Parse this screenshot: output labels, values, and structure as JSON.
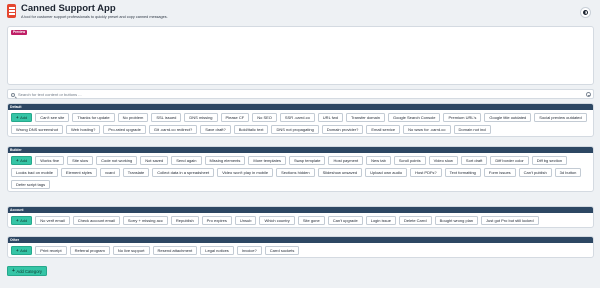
{
  "app": {
    "title": "Canned Support App",
    "subtitle": "A tool for customer support professionals to quickly preset and copy canned messages.",
    "logo_icon": "notebook-icon",
    "theme_icon": "contrast-icon"
  },
  "preview": {
    "badge": "Preview"
  },
  "search": {
    "placeholder": "Search for text content or buttons ...",
    "value": ""
  },
  "add_label": "Add",
  "add_category_label": "Add Category",
  "colors": {
    "accent": "#35c5a6",
    "category_header": "#2d4763",
    "preview_badge": "#bf1f66",
    "logo": "#e4472f",
    "background": "#eef1f4"
  },
  "categories": [
    {
      "name": "Default",
      "buttons": [
        "Can't see site",
        "Thanks for update",
        "No problem",
        "SSL issued",
        "DNS missing",
        "Please CF",
        "No SEO",
        "SSR .carrd.co",
        "URL fwd",
        "Transfer domain",
        "Google Search Console",
        "Premium URL's",
        "Google title outdated",
        "Social preview outdated",
        "Wrong DNS screenshot",
        "Web hosting?",
        "Pro-rated upgrade",
        "Git .carrd.co redirect?",
        "Save draft?",
        "Bold/italic text",
        "DNS not propagating",
        "Domain provider?",
        "Email service",
        "No www for .carrd.co",
        "Domain not incl"
      ]
    },
    {
      "name": "Builder",
      "buttons": [
        "Works fine",
        "Site slow",
        "Code not working",
        "Not saved",
        "Send again",
        "Missing elements",
        "More templates",
        "Swap template",
        "Host payment",
        "New tab",
        "Scroll points",
        "Video slow",
        "Sort draft",
        "Diff border color",
        "Diff bg section",
        "Looks bad on mobile",
        "Element styles",
        "vcard",
        "Translate",
        "Collect data in a spreadsheet",
        "Video won't play in mobile",
        "Sections hidden",
        "Slideshow unsaved",
        "Upload own audio",
        "Host PDFs?",
        "Text formatting",
        "Form issues",
        "Can't publish",
        "3d button",
        "Defer script tags"
      ]
    },
    {
      "name": "Account",
      "buttons": [
        "No verif email",
        "Check account email",
        "Sorry + missing acc",
        "Republish",
        "Pro expires",
        "Unsub",
        "Which country",
        "Site gone",
        "Can't upgrade",
        "Login issue",
        "Delete Carrd",
        "Bought wrong plan",
        "Just got Pro but still locked"
      ]
    },
    {
      "name": "Other",
      "buttons": [
        "Print receipt",
        "Referral program",
        "No live support",
        "Resend attachment",
        "Legal notices",
        "Invoice?",
        "Carrd sockets"
      ]
    }
  ]
}
